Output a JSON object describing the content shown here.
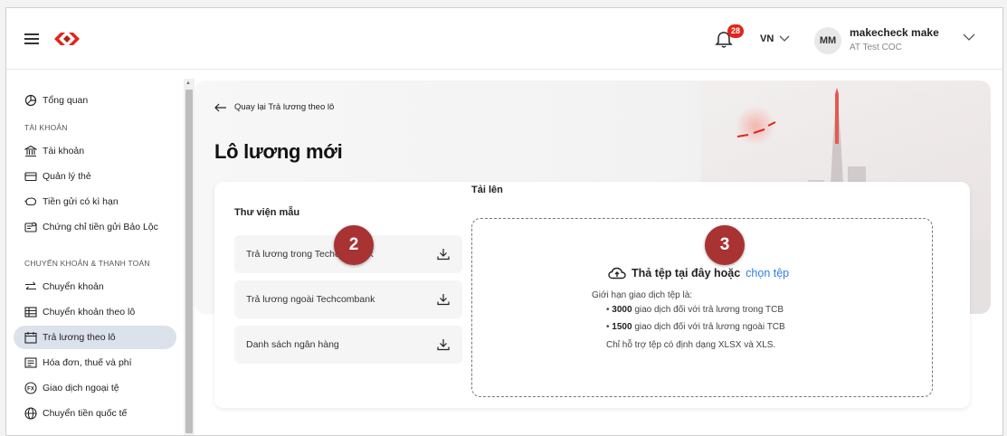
{
  "header": {
    "notification_count": "28",
    "language": "VN",
    "avatar_initials": "MM",
    "user_name": "makecheck make",
    "user_subtitle": "AT Test COC"
  },
  "sidebar": {
    "overview": "Tổng quan",
    "section_accounts": "TÀI KHOẢN",
    "accounts": [
      "Tài khoản",
      "Quản lý thẻ",
      "Tiền gửi có kì hạn",
      "Chứng chỉ tiền gửi Bảo Lộc"
    ],
    "section_transfers": "CHUYỂN KHOẢN & THANH TOÁN",
    "transfers": [
      "Chuyển khoản",
      "Chuyển khoản theo lô",
      "Trả lương theo lô",
      "Hóa đơn, thuế và phí",
      "Giao dịch ngoại tệ",
      "Chuyển tiền quốc tế"
    ],
    "active_item": "Trả lương theo lô"
  },
  "page": {
    "back_link": "Quay lại Trả lương theo lô",
    "title": "Lô lương mới"
  },
  "library": {
    "title": "Thư viện mẫu",
    "items": [
      "Trả lương trong Techcombank",
      "Trả lương ngoài Techcombank",
      "Danh sách ngân hàng"
    ]
  },
  "upload": {
    "title": "Tải lên",
    "drop_text": "Thả tệp tại đây hoặc",
    "choose_link": "chọn tệp",
    "limit_intro": "Giới hạn giao dịch tệp là:",
    "limit_1_value": "3000",
    "limit_1_text": "giao dịch đối với trả lương trong TCB",
    "limit_2_value": "1500",
    "limit_2_text": "giao dịch đối với trả lương ngoài TCB",
    "format_note": "Chỉ hỗ trợ tệp có định dạng XLSX và XLS."
  },
  "annotations": [
    "2",
    "3"
  ],
  "colors": {
    "brand_red": "#e0261b",
    "active_bg": "#dbe2ec",
    "link_blue": "#2f7fe0",
    "step_badge": "#a93232"
  }
}
